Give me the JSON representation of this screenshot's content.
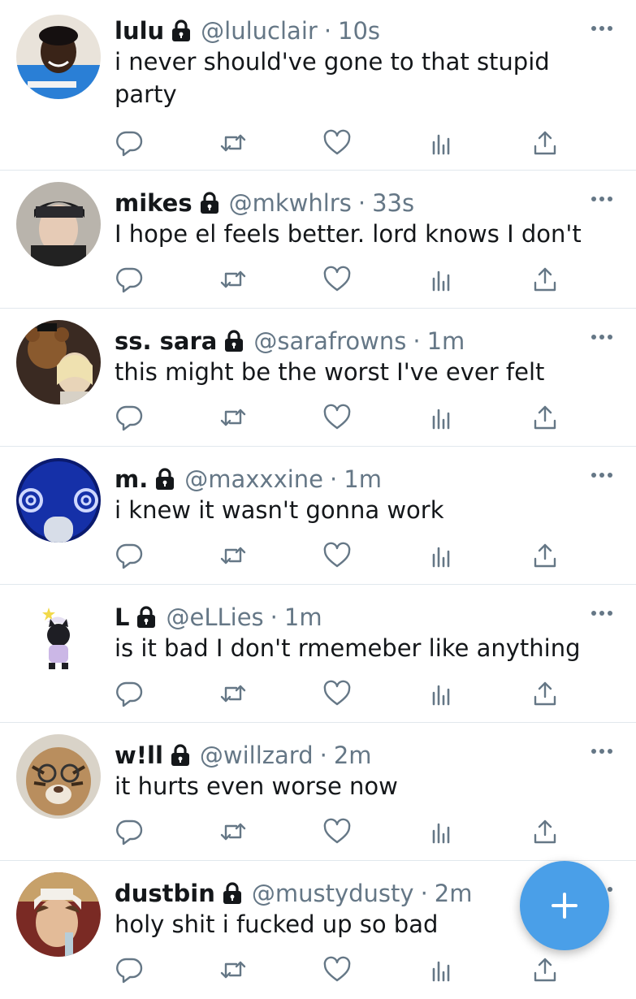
{
  "feed": {
    "tweets": [
      {
        "name": "lulu",
        "handle": "@luluclair",
        "separator": "·",
        "time": "10s",
        "text": "i never should've gone to that stupid party"
      },
      {
        "name": "mikes",
        "handle": "@mkwhlrs",
        "separator": "·",
        "time": "33s",
        "text": "I hope el feels better. lord knows I don't"
      },
      {
        "name": "ss. sara",
        "handle": "@sarafrowns",
        "separator": "·",
        "time": "1m",
        "text": "this might be the worst I've ever felt"
      },
      {
        "name": "m.",
        "handle": "@maxxxine",
        "separator": "·",
        "time": "1m",
        "text": "i knew it wasn't gonna work"
      },
      {
        "name": "L",
        "handle": "@eLLies",
        "separator": "·",
        "time": "1m",
        "text": "is it bad I don't rmemeber like anything"
      },
      {
        "name": "w!ll",
        "handle": "@willzard",
        "separator": "·",
        "time": "2m",
        "text": "it hurts even worse now"
      },
      {
        "name": "dustbin",
        "handle": "@mustydusty",
        "separator": "·",
        "time": "2m",
        "text": "holy shit i fucked up so bad"
      }
    ]
  },
  "icons": {
    "lock": "lock-icon",
    "more": "more-dots-icon",
    "reply": "reply-icon",
    "retweet": "retweet-icon",
    "like": "like-heart-icon",
    "stats": "analytics-icon",
    "share": "share-icon",
    "compose": "plus-icon"
  },
  "colors": {
    "text": "#14171a",
    "secondary": "#657786",
    "divider": "#e1e8ed",
    "accent": "#4a9fe8"
  }
}
